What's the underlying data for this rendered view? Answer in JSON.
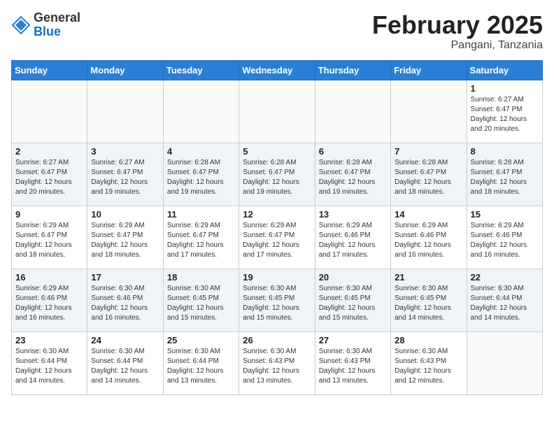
{
  "logo": {
    "general": "General",
    "blue": "Blue"
  },
  "title": "February 2025",
  "location": "Pangani, Tanzania",
  "days_of_week": [
    "Sunday",
    "Monday",
    "Tuesday",
    "Wednesday",
    "Thursday",
    "Friday",
    "Saturday"
  ],
  "weeks": [
    [
      {
        "day": "",
        "info": ""
      },
      {
        "day": "",
        "info": ""
      },
      {
        "day": "",
        "info": ""
      },
      {
        "day": "",
        "info": ""
      },
      {
        "day": "",
        "info": ""
      },
      {
        "day": "",
        "info": ""
      },
      {
        "day": "1",
        "info": "Sunrise: 6:27 AM\nSunset: 6:47 PM\nDaylight: 12 hours and 20 minutes."
      }
    ],
    [
      {
        "day": "2",
        "info": "Sunrise: 6:27 AM\nSunset: 6:47 PM\nDaylight: 12 hours and 20 minutes."
      },
      {
        "day": "3",
        "info": "Sunrise: 6:27 AM\nSunset: 6:47 PM\nDaylight: 12 hours and 19 minutes."
      },
      {
        "day": "4",
        "info": "Sunrise: 6:28 AM\nSunset: 6:47 PM\nDaylight: 12 hours and 19 minutes."
      },
      {
        "day": "5",
        "info": "Sunrise: 6:28 AM\nSunset: 6:47 PM\nDaylight: 12 hours and 19 minutes."
      },
      {
        "day": "6",
        "info": "Sunrise: 6:28 AM\nSunset: 6:47 PM\nDaylight: 12 hours and 19 minutes."
      },
      {
        "day": "7",
        "info": "Sunrise: 6:28 AM\nSunset: 6:47 PM\nDaylight: 12 hours and 18 minutes."
      },
      {
        "day": "8",
        "info": "Sunrise: 6:28 AM\nSunset: 6:47 PM\nDaylight: 12 hours and 18 minutes."
      }
    ],
    [
      {
        "day": "9",
        "info": "Sunrise: 6:29 AM\nSunset: 6:47 PM\nDaylight: 12 hours and 18 minutes."
      },
      {
        "day": "10",
        "info": "Sunrise: 6:29 AM\nSunset: 6:47 PM\nDaylight: 12 hours and 18 minutes."
      },
      {
        "day": "11",
        "info": "Sunrise: 6:29 AM\nSunset: 6:47 PM\nDaylight: 12 hours and 17 minutes."
      },
      {
        "day": "12",
        "info": "Sunrise: 6:29 AM\nSunset: 6:47 PM\nDaylight: 12 hours and 17 minutes."
      },
      {
        "day": "13",
        "info": "Sunrise: 6:29 AM\nSunset: 6:46 PM\nDaylight: 12 hours and 17 minutes."
      },
      {
        "day": "14",
        "info": "Sunrise: 6:29 AM\nSunset: 6:46 PM\nDaylight: 12 hours and 16 minutes."
      },
      {
        "day": "15",
        "info": "Sunrise: 6:29 AM\nSunset: 6:46 PM\nDaylight: 12 hours and 16 minutes."
      }
    ],
    [
      {
        "day": "16",
        "info": "Sunrise: 6:29 AM\nSunset: 6:46 PM\nDaylight: 12 hours and 16 minutes."
      },
      {
        "day": "17",
        "info": "Sunrise: 6:30 AM\nSunset: 6:46 PM\nDaylight: 12 hours and 16 minutes."
      },
      {
        "day": "18",
        "info": "Sunrise: 6:30 AM\nSunset: 6:45 PM\nDaylight: 12 hours and 15 minutes."
      },
      {
        "day": "19",
        "info": "Sunrise: 6:30 AM\nSunset: 6:45 PM\nDaylight: 12 hours and 15 minutes."
      },
      {
        "day": "20",
        "info": "Sunrise: 6:30 AM\nSunset: 6:45 PM\nDaylight: 12 hours and 15 minutes."
      },
      {
        "day": "21",
        "info": "Sunrise: 6:30 AM\nSunset: 6:45 PM\nDaylight: 12 hours and 14 minutes."
      },
      {
        "day": "22",
        "info": "Sunrise: 6:30 AM\nSunset: 6:44 PM\nDaylight: 12 hours and 14 minutes."
      }
    ],
    [
      {
        "day": "23",
        "info": "Sunrise: 6:30 AM\nSunset: 6:44 PM\nDaylight: 12 hours and 14 minutes."
      },
      {
        "day": "24",
        "info": "Sunrise: 6:30 AM\nSunset: 6:44 PM\nDaylight: 12 hours and 14 minutes."
      },
      {
        "day": "25",
        "info": "Sunrise: 6:30 AM\nSunset: 6:44 PM\nDaylight: 12 hours and 13 minutes."
      },
      {
        "day": "26",
        "info": "Sunrise: 6:30 AM\nSunset: 6:43 PM\nDaylight: 12 hours and 13 minutes."
      },
      {
        "day": "27",
        "info": "Sunrise: 6:30 AM\nSunset: 6:43 PM\nDaylight: 12 hours and 13 minutes."
      },
      {
        "day": "28",
        "info": "Sunrise: 6:30 AM\nSunset: 6:43 PM\nDaylight: 12 hours and 12 minutes."
      },
      {
        "day": "",
        "info": ""
      }
    ]
  ]
}
